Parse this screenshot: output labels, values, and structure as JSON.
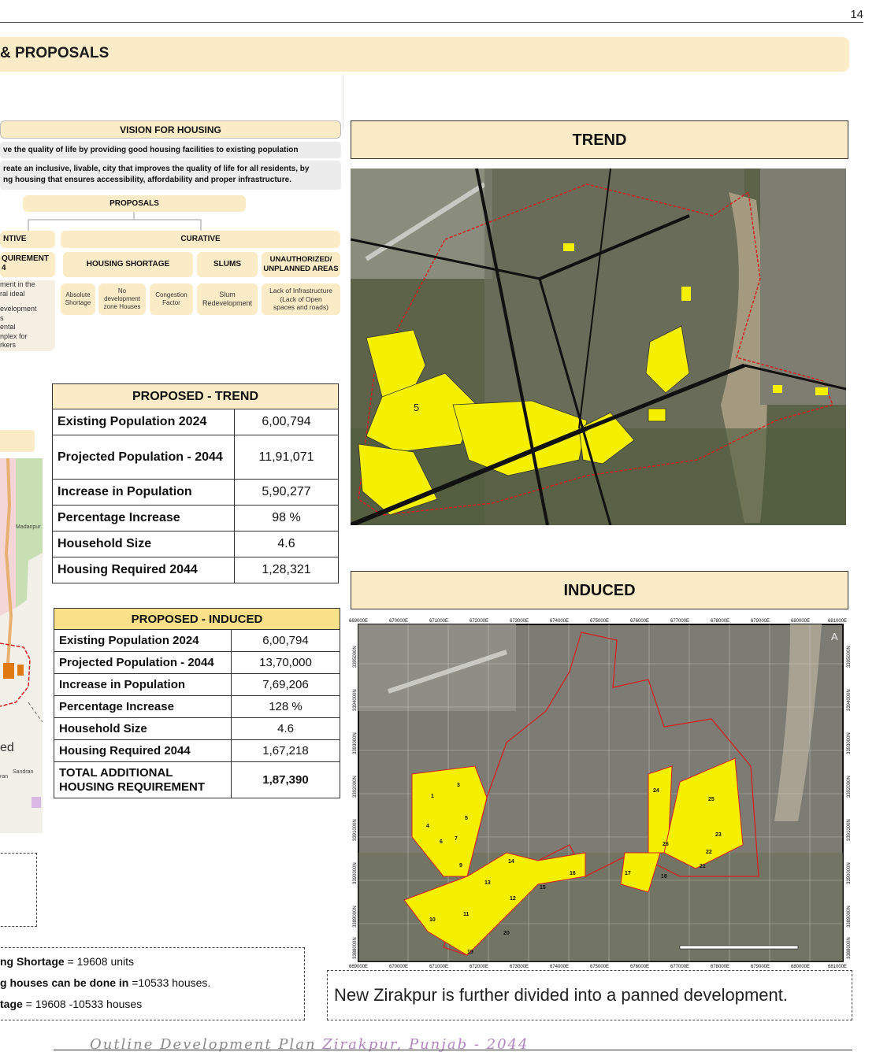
{
  "page_number": "14",
  "section_title": "& PROPOSALS",
  "vision": {
    "title": "VISION FOR HOUSING",
    "line1": "ve the quality of life by providing good housing facilities to existing population",
    "line2a": "reate an inclusive, livable, city that improves the quality of life for all residents, by",
    "line2b": "ng housing that ensures accessibility, affordability and proper infrastructure.",
    "proposals_label": "PROPOSALS",
    "preventive_label": "NTIVE",
    "curative_label": "CURATIVE",
    "req_label_a": "QUIREMENT",
    "req_label_b": "4",
    "req_text": [
      "ment in the",
      "ral ideal",
      "",
      "evelopment",
      "s",
      "ental",
      "nplex for",
      "rkers"
    ],
    "shortage_label": "HOUSING SHORTAGE",
    "slums_label": "SLUMS",
    "unauth_label_a": "UNAUTHORIZED/",
    "unauth_label_b": "UNPLANNED AREAS",
    "absolute": [
      "Absolute",
      "Shortage"
    ],
    "no_dev": [
      "No",
      "development",
      "zone Houses"
    ],
    "congestion": [
      "Congestion",
      "Factor"
    ],
    "slum_redev": [
      "Slum",
      "Redevelopment"
    ],
    "lack_infra": [
      "Lack of Infrastructure",
      "(Lack of Open",
      "spaces and roads)"
    ]
  },
  "trend_table": {
    "title": "PROPOSED - TREND",
    "rows": [
      {
        "k": "Existing Population 2024",
        "v": "6,00,794"
      },
      {
        "k": "Projected Population - 2044",
        "v": "11,91,071"
      },
      {
        "k": "Increase in Population",
        "v": "5,90,277"
      },
      {
        "k": "Percentage Increase",
        "v": "98 %"
      },
      {
        "k": "Household Size",
        "v": "4.6"
      },
      {
        "k": "Housing Required 2044",
        "v": "1,28,321"
      }
    ]
  },
  "induced_table": {
    "title": "PROPOSED - INDUCED",
    "rows": [
      {
        "k": "Existing Population 2024",
        "v": "6,00,794"
      },
      {
        "k": "Projected Population - 2044",
        "v": "13,70,000"
      },
      {
        "k": "Increase in Population",
        "v": "7,69,206"
      },
      {
        "k": "Percentage Increase",
        "v": "128 %"
      },
      {
        "k": "Household Size",
        "v": "4.6"
      },
      {
        "k": "Housing Required 2044",
        "v": "1,67,218"
      }
    ],
    "total_k1": "TOTAL ADDITIONAL",
    "total_k2": "HOUSING REQUIREMENT",
    "total_v": "1,87,390"
  },
  "left_map": {
    "madanpur": "Madanpur",
    "ed": "ed",
    "sandran": "Sandran",
    "ran": "ran"
  },
  "shortage_box": {
    "l1b": "ng Shortage",
    "l1r": " = 19608 units",
    "l2b": "g houses can be done in",
    "l2r": "  =10533 houses.",
    "l3b": "tage",
    "l3r": " = 19608 -10533 houses"
  },
  "trend_map": {
    "title": "TREND",
    "label5": "5"
  },
  "induced_map": {
    "title": "INDUCED",
    "x_ticks": [
      "669000E",
      "670000E",
      "671000E",
      "672000E",
      "673000E",
      "674000E",
      "675000E",
      "676000E",
      "677000E",
      "678000E",
      "679000E",
      "680000E",
      "681000E"
    ],
    "y_ticks": [
      "3395000N",
      "3394000N",
      "3393000N",
      "3392000N",
      "3391000N",
      "3390000N",
      "3389000N",
      "3388000N"
    ],
    "zones": [
      "1",
      "3",
      "4",
      "5",
      "6",
      "7",
      "9",
      "10",
      "11",
      "12",
      "13",
      "14",
      "15",
      "16",
      "17",
      "18",
      "19",
      "20",
      "21",
      "22",
      "23",
      "24",
      "25",
      "26"
    ],
    "north_arrow": "A"
  },
  "note": "New Zirakpur is further divided into a panned development.",
  "footer": {
    "part1": "Outline Development Plan ",
    "part2": "Zirakpur, Punjab - 2044"
  },
  "colors": {
    "accent": "#fbecc7",
    "zone_yellow": "#f4f000",
    "boundary_red": "#d42020",
    "footer_grey": "#8a8a8a",
    "footer_purple": "#b184c0"
  }
}
